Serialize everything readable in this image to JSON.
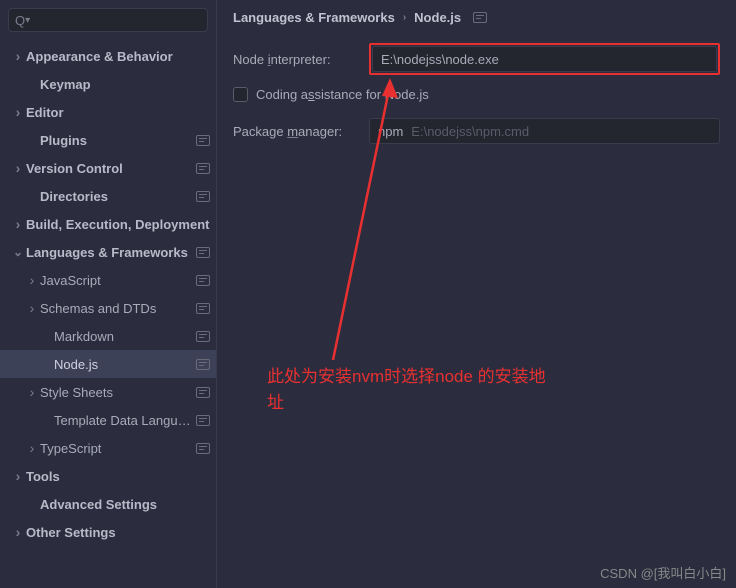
{
  "search": {
    "placeholder": ""
  },
  "breadcrumb": {
    "root": "Languages & Frameworks",
    "current": "Node.js"
  },
  "form": {
    "interpreter_label": "Node interpreter:",
    "interpreter_value": "E:\\nodejss\\node.exe",
    "coding_assist": "Coding assistance for Node.js",
    "package_manager_label": "Package manager:",
    "package_manager_value": "npm",
    "package_manager_path": "E:\\nodejss\\npm.cmd"
  },
  "sidebar": {
    "items": [
      {
        "label": "Appearance & Behavior",
        "bold": true,
        "state": "collapsed",
        "indent": 12,
        "badge": false
      },
      {
        "label": "Keymap",
        "bold": true,
        "state": "leaf",
        "indent": 12,
        "badge": false,
        "pad": 14
      },
      {
        "label": "Editor",
        "bold": true,
        "state": "collapsed",
        "indent": 12,
        "badge": false
      },
      {
        "label": "Plugins",
        "bold": true,
        "state": "leaf",
        "indent": 12,
        "badge": true,
        "pad": 14
      },
      {
        "label": "Version Control",
        "bold": true,
        "state": "collapsed",
        "indent": 12,
        "badge": true
      },
      {
        "label": "Directories",
        "bold": true,
        "state": "leaf",
        "indent": 12,
        "badge": true,
        "pad": 14
      },
      {
        "label": "Build, Execution, Deployment",
        "bold": true,
        "state": "collapsed",
        "indent": 12,
        "badge": false
      },
      {
        "label": "Languages & Frameworks",
        "bold": true,
        "state": "expanded",
        "indent": 12,
        "badge": true
      },
      {
        "label": "JavaScript",
        "bold": false,
        "state": "collapsed",
        "indent": 26,
        "badge": true
      },
      {
        "label": "Schemas and DTDs",
        "bold": false,
        "state": "collapsed",
        "indent": 26,
        "badge": true
      },
      {
        "label": "Markdown",
        "bold": false,
        "state": "leaf",
        "indent": 40,
        "badge": true
      },
      {
        "label": "Node.js",
        "bold": false,
        "state": "leaf",
        "indent": 40,
        "badge": true,
        "selected": true
      },
      {
        "label": "Style Sheets",
        "bold": false,
        "state": "collapsed",
        "indent": 26,
        "badge": true
      },
      {
        "label": "Template Data Languages",
        "bold": false,
        "state": "leaf",
        "indent": 40,
        "badge": true
      },
      {
        "label": "TypeScript",
        "bold": false,
        "state": "collapsed",
        "indent": 26,
        "badge": true
      },
      {
        "label": "Tools",
        "bold": true,
        "state": "collapsed",
        "indent": 12,
        "badge": false
      },
      {
        "label": "Advanced Settings",
        "bold": true,
        "state": "leaf",
        "indent": 12,
        "badge": false,
        "pad": 14
      },
      {
        "label": "Other Settings",
        "bold": true,
        "state": "collapsed",
        "indent": 12,
        "badge": false
      }
    ]
  },
  "annotation": "此处为安装nvm时选择node 的安装地址",
  "watermark": "CSDN @[我叫白小白]"
}
